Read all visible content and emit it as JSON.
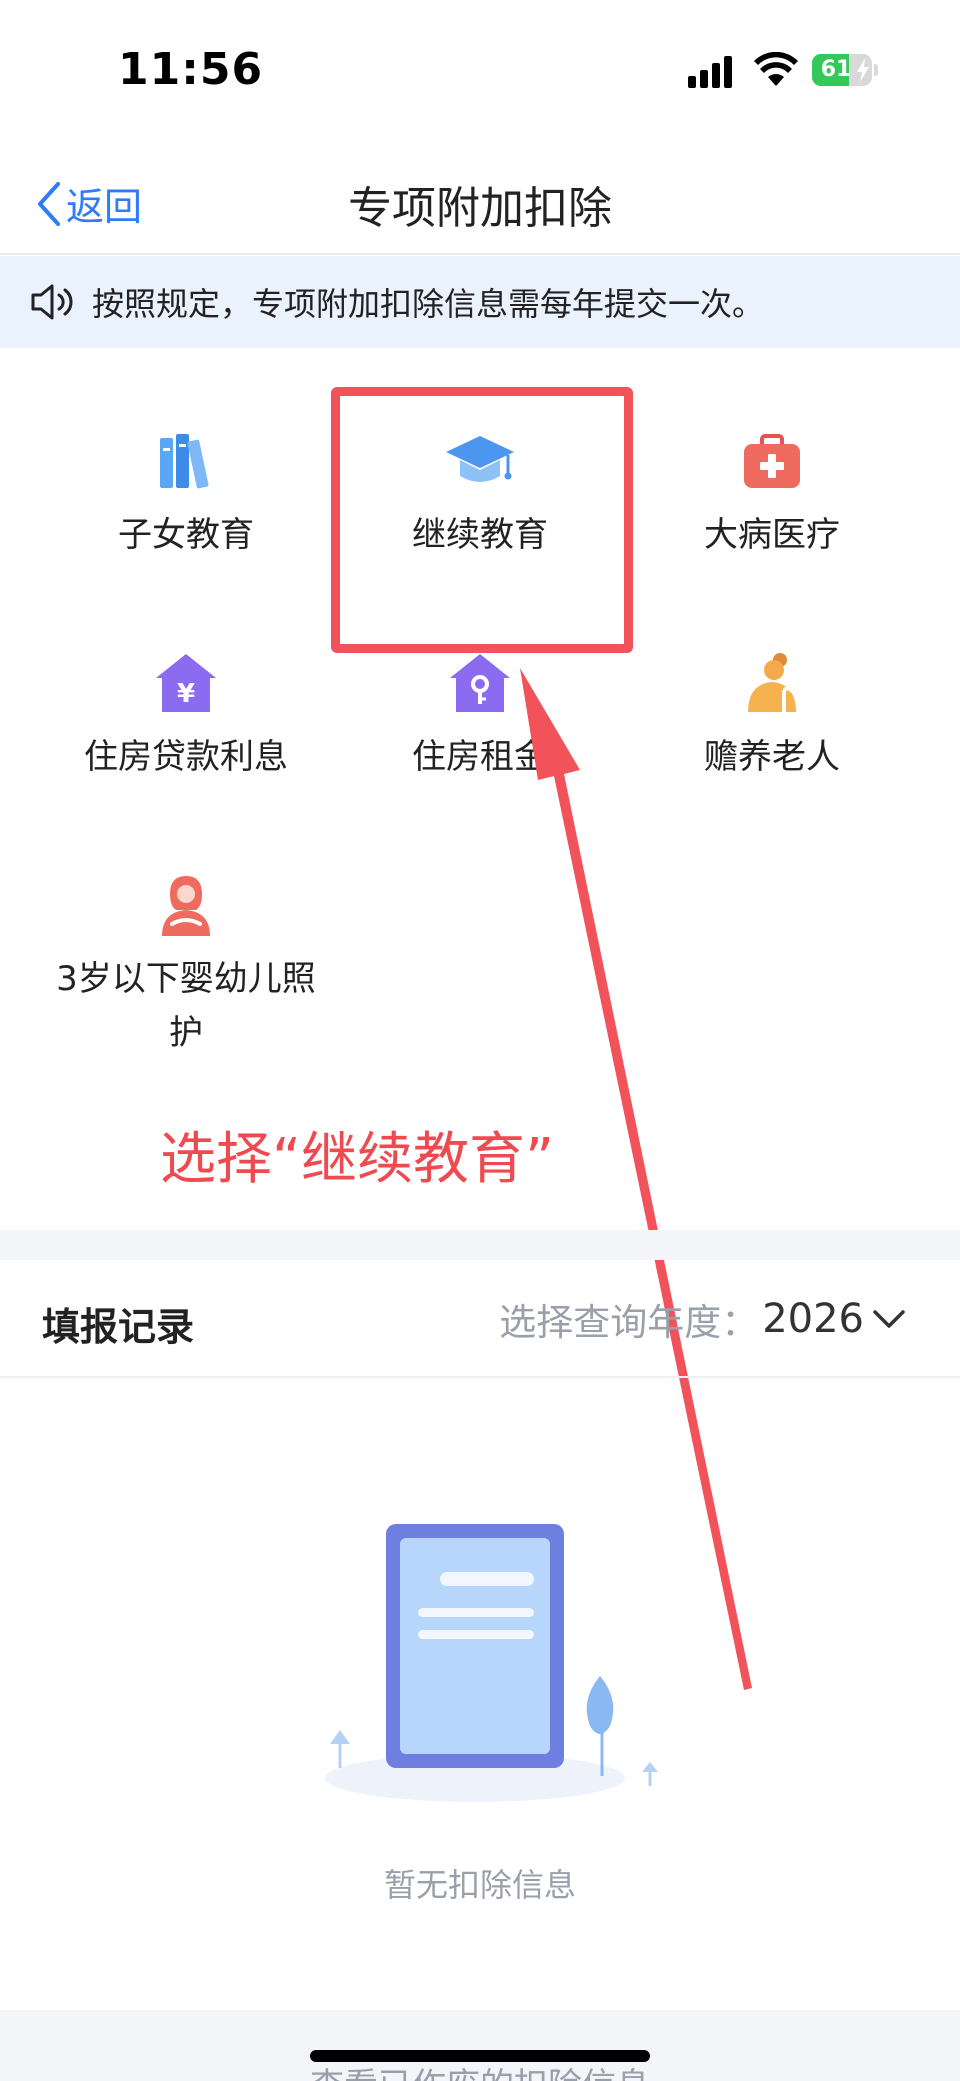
{
  "status_bar": {
    "time": "11:56",
    "battery": "61",
    "battery_level": 0.61
  },
  "nav": {
    "back_label": "返回",
    "title": "专项附加扣除"
  },
  "notice": {
    "text": "按照规定，专项附加扣除信息需每年提交一次。"
  },
  "categories": [
    {
      "label": "子女教育",
      "icon": "books-icon"
    },
    {
      "label": "继续教育",
      "icon": "graduation-cap-icon"
    },
    {
      "label": "大病医疗",
      "icon": "medical-kit-icon"
    },
    {
      "label": "住房贷款利息",
      "icon": "house-yen-icon"
    },
    {
      "label": "住房租金",
      "icon": "house-key-icon"
    },
    {
      "label": "赡养老人",
      "icon": "elderly-person-icon"
    },
    {
      "label": "3岁以下婴幼儿照\n护",
      "icon": "mother-baby-icon"
    }
  ],
  "annotation": {
    "text": "选择“继续教育”",
    "color": "#ef4a50"
  },
  "records": {
    "title": "填报记录",
    "year_label": "选择查询年度：",
    "year_value": "2026",
    "empty_text": "暂无扣除信息"
  },
  "bottom": {
    "link_text": "查看已作废的扣除信息"
  },
  "colors": {
    "accent": "#2f7cf6",
    "notice_bg": "#e9f2fd",
    "highlight": "#f2535a"
  }
}
